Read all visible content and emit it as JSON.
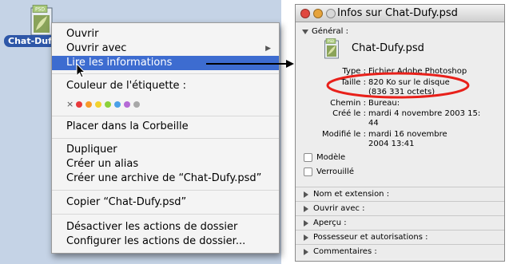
{
  "desktop": {
    "file_icon_label": "PSD",
    "file_label": "Chat-Dufy.psd"
  },
  "context_menu": {
    "open": "Ouvrir",
    "open_with": "Ouvrir avec",
    "get_info": "Lire les informations",
    "label_color": "Couleur de l'étiquette :",
    "label_none": "×",
    "label_colors": [
      "#e8393c",
      "#f79a2a",
      "#f2d22e",
      "#8bd13a",
      "#4aa0e8",
      "#b56ad6",
      "#a8a8a8"
    ],
    "move_to_trash": "Placer dans la Corbeille",
    "duplicate": "Dupliquer",
    "make_alias": "Créer un alias",
    "create_archive": "Créer une archive de “Chat-Dufy.psd”",
    "copy": "Copier “Chat-Dufy.psd”",
    "disable_folder_actions": "Désactiver les actions de dossier",
    "configure_folder_actions": "Configurer les actions de dossier..."
  },
  "info_window": {
    "title": "Infos sur Chat-Dufy.psd",
    "general_header": "Général :",
    "file_name": "Chat-Dufy.psd",
    "file_icon_label": "PSD",
    "type_label": "Type :",
    "type_value": "Fichier Adobe Photoshop",
    "size_label": "Taille :",
    "size_value_1": "820 Ko sur le disque",
    "size_value_2": "(836 331 octets)",
    "path_label": "Chemin :",
    "path_value": "Bureau:",
    "created_label": "Créé le :",
    "created_value_1": "mardi 4 novembre 2003 15:",
    "created_value_2": "44",
    "modified_label": "Modifié le :",
    "modified_value_1": "mardi 16 novembre",
    "modified_value_2": "2004 13:41",
    "template_checkbox": "Modèle",
    "locked_checkbox": "Verrouillé",
    "sections": [
      "Nom et extension :",
      "Ouvrir avec :",
      "Aperçu :",
      "Possesseur et autorisations :",
      "Commentaires :"
    ]
  },
  "colors": {
    "menu_highlight": "#3d6cd0",
    "highlight_ellipse": "#e8201a",
    "desktop_bg": "#c5d3e6"
  }
}
